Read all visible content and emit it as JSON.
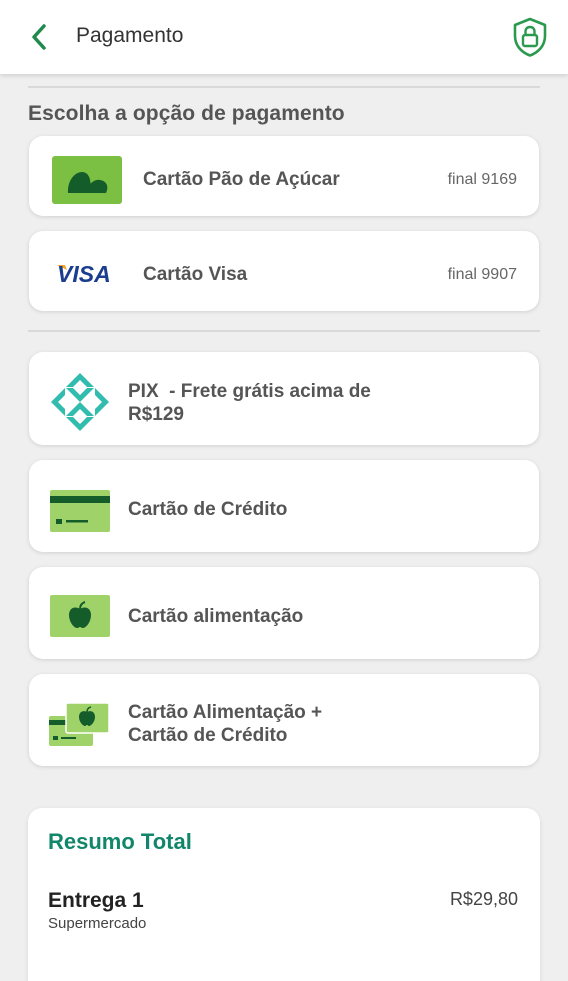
{
  "header": {
    "title": "Pagamento",
    "back_icon": "chevron-left-icon",
    "security_icon": "shield-lock-icon",
    "accent_color": "#1f8a4c"
  },
  "section": {
    "title": "Escolha a opção de pagamento"
  },
  "saved_cards": [
    {
      "label": "Cartão Pão de Açúcar",
      "final": "final 9169",
      "icon": "pao-de-acucar-logo"
    },
    {
      "label": "Cartão Visa",
      "final": "final 9907",
      "icon": "visa-logo",
      "brand_text": "VISA"
    }
  ],
  "payment_options": [
    {
      "label_line1": "PIX  - Frete grátis acima de",
      "label_line2": "R$129",
      "icon": "pix-icon"
    },
    {
      "label": "Cartão de Crédito",
      "icon": "credit-card-icon"
    },
    {
      "label": "Cartão alimentação",
      "icon": "apple-card-icon"
    },
    {
      "label_line1": "Cartão Alimentação +",
      "label_line2": "Cartão de Crédito",
      "icon": "combined-cards-icon"
    }
  ],
  "summary": {
    "title": "Resumo Total",
    "delivery_title": "Entrega 1",
    "delivery_sub": "Supermercado",
    "delivery_price": "R$29,80"
  }
}
